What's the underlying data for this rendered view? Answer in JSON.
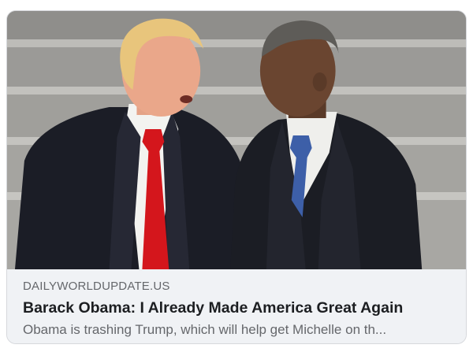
{
  "link_preview": {
    "domain": "DAILYWORLDUPDATE.US",
    "headline": "Barack Obama: I Already Made America Great Again",
    "description": "Obama is trashing Trump, which will help get Michelle on th...",
    "image": {
      "subject": "two men in dark suits talking in front of stone steps",
      "left_tie_color": "#d4161c",
      "right_tie_color": "#3d5fa8"
    }
  }
}
